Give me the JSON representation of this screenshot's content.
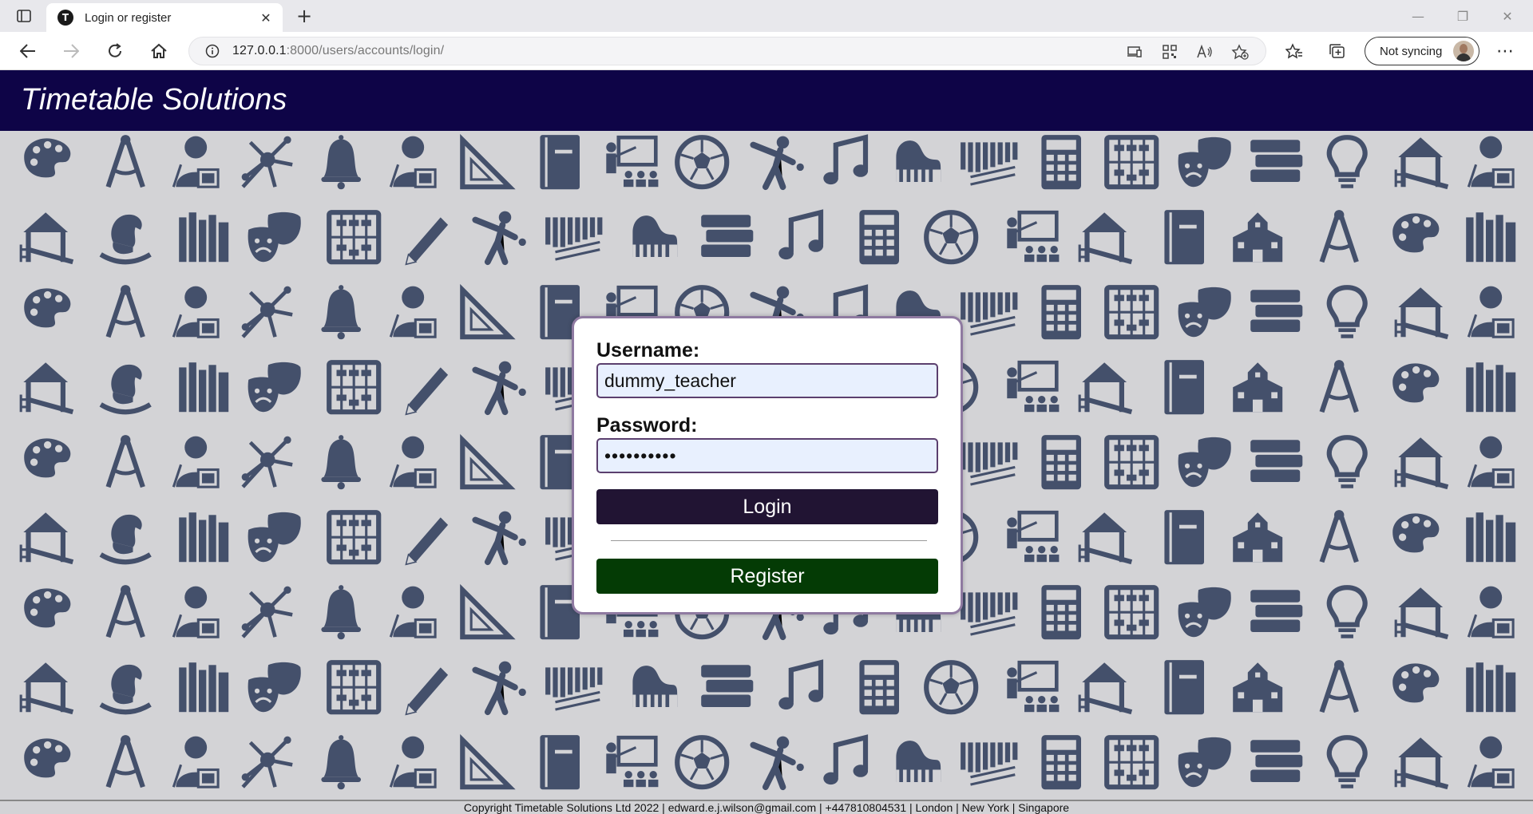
{
  "browser": {
    "tab_title": "Login or register",
    "tab_favicon_letter": "T",
    "url_host": "127.0.0.1",
    "url_rest": ":8000/users/accounts/login/",
    "profile_label": "Not syncing"
  },
  "header": {
    "title": "Timetable Solutions"
  },
  "login": {
    "username_label": "Username:",
    "username_value": "dummy_teacher",
    "password_label": "Password:",
    "password_value": "••••••••••",
    "login_button": "Login",
    "register_button": "Register"
  },
  "footer": {
    "text": "Copyright Timetable Solutions Ltd 2022 | edward.e.j.wilson@gmail.com | +447810804531 | London | New York | Singapore"
  },
  "colors": {
    "header_bg": "#0e0447",
    "icon_color": "#44506b",
    "login_button_bg": "#211433",
    "register_button_bg": "#043b05"
  }
}
